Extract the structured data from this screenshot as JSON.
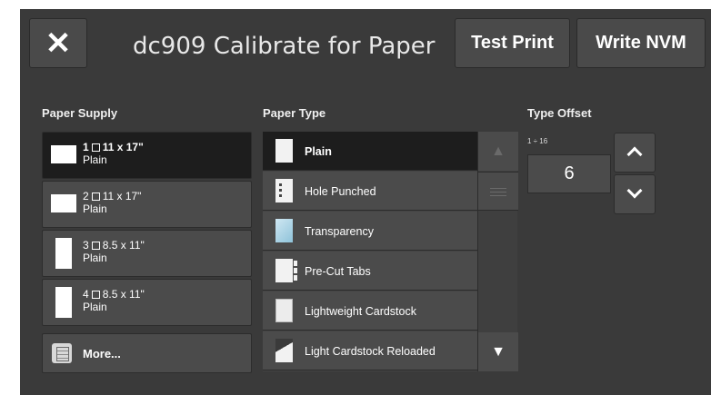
{
  "header": {
    "close_glyph": "✕",
    "title": "dc909 Calibrate for Paper",
    "test_print_label": "Test Print",
    "write_nvm_label": "Write NVM"
  },
  "paper_supply": {
    "label": "Paper Supply",
    "trays": [
      {
        "tray": "1",
        "size": "11 x 17\"",
        "type": "Plain",
        "orientation": "landscape",
        "selected": true
      },
      {
        "tray": "2",
        "size": "11 x 17\"",
        "type": "Plain",
        "orientation": "landscape",
        "selected": false
      },
      {
        "tray": "3",
        "size": "8.5 x 11\"",
        "type": "Plain",
        "orientation": "portrait",
        "selected": false
      },
      {
        "tray": "4",
        "size": "8.5 x 11\"",
        "type": "Plain",
        "orientation": "portrait",
        "selected": false
      }
    ],
    "more_label": "More..."
  },
  "paper_type": {
    "label": "Paper Type",
    "items": [
      {
        "label": "Plain",
        "icon": "plain-paper-icon",
        "selected": true
      },
      {
        "label": "Hole Punched",
        "icon": "hole-punched-paper-icon",
        "selected": false
      },
      {
        "label": "Transparency",
        "icon": "transparency-icon",
        "selected": false
      },
      {
        "label": "Pre-Cut Tabs",
        "icon": "pre-cut-tabs-icon",
        "selected": false
      },
      {
        "label": "Lightweight Cardstock",
        "icon": "cardstock-icon",
        "selected": false
      },
      {
        "label": "Light Cardstock Reloaded",
        "icon": "reloaded-cardstock-icon",
        "selected": false
      }
    ],
    "scroll_up_glyph": "▲",
    "scroll_down_glyph": "▼"
  },
  "type_offset": {
    "label": "Type Offset",
    "range": "1 ÷ 16",
    "value": "6"
  },
  "colors": {
    "panel": "#3a3a3a",
    "button": "#4b4b4b",
    "selected": "#1d1d1d",
    "text": "#ffffff"
  }
}
